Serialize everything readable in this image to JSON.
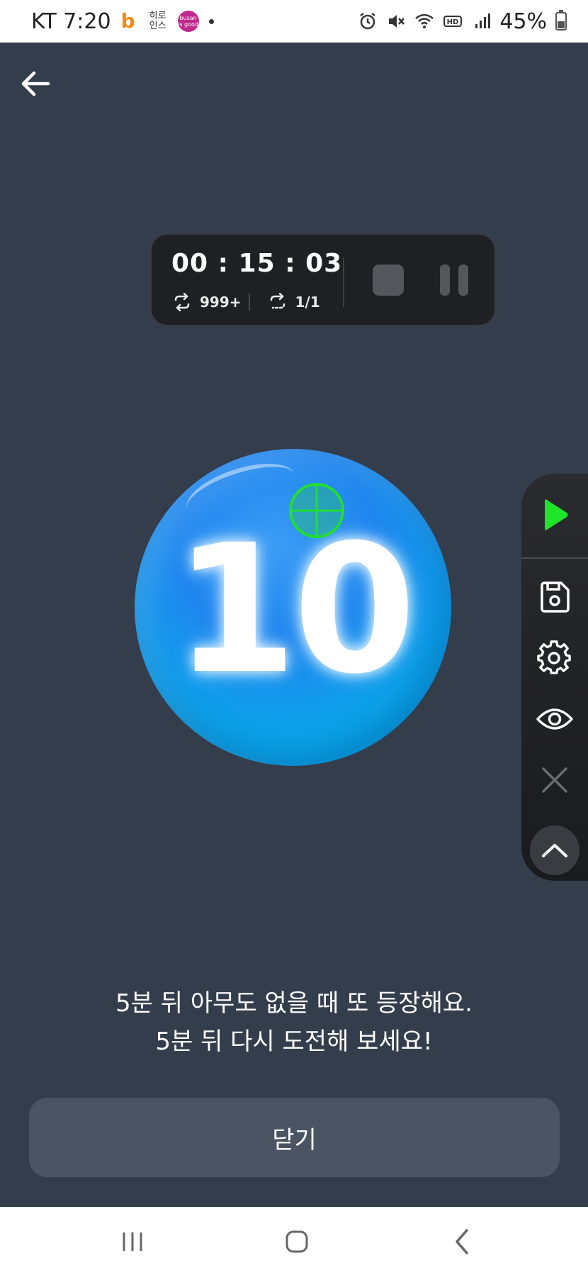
{
  "status_bar": {
    "carrier_time": "KT 7:20",
    "app_b_letter": "b",
    "app_hiro": "히로\n인스",
    "app_busan": "busan is good",
    "battery": "45%",
    "icons": [
      "alarm-icon",
      "mute-icon",
      "wifi-icon",
      "hd-icon",
      "signal-icon",
      "battery-icon"
    ]
  },
  "timer": {
    "time": "00 : 15 : 03",
    "repeat_count": "999+",
    "round": "1/1"
  },
  "ball": {
    "number": "10",
    "color": "#1f86ef"
  },
  "toolbar": {
    "items": [
      "play-icon",
      "save-icon",
      "gear-icon",
      "eye-icon",
      "close-icon",
      "chevron-up-icon"
    ],
    "play_color": "#1ee52a"
  },
  "message": {
    "line1": "5분 뒤 아무도 없을 때 또 등장해요.",
    "line2": "5분 뒤 다시 도전해 보세요!"
  },
  "close_button": {
    "label": "닫기"
  },
  "nav_bar": {
    "items": [
      "recent-apps-icon",
      "home-icon",
      "back-icon"
    ]
  }
}
